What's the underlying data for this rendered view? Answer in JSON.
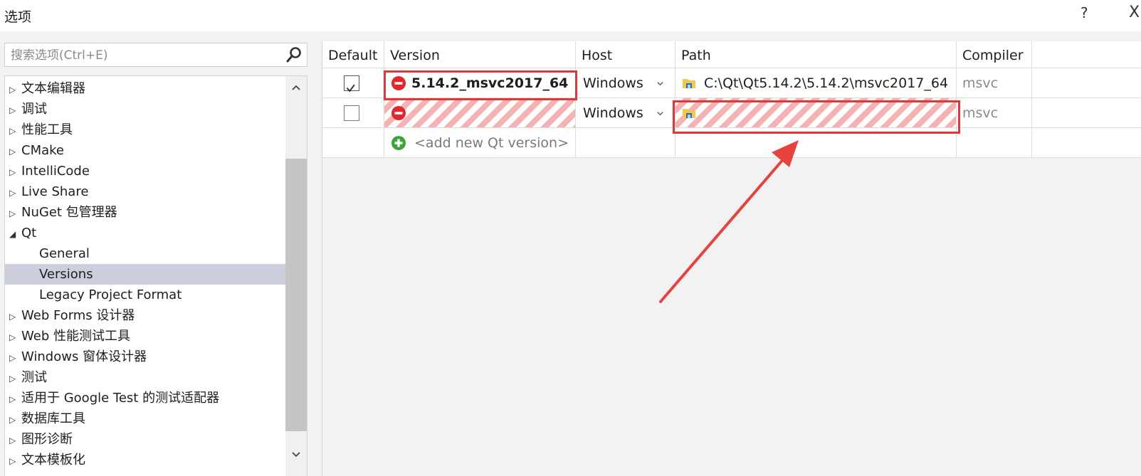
{
  "window": {
    "title": "选项",
    "help_label": "?",
    "close_label": "X"
  },
  "search": {
    "placeholder": "搜索选项(Ctrl+E)",
    "value": ""
  },
  "tree": {
    "items": [
      {
        "label": "文本编辑器",
        "expander": "▷"
      },
      {
        "label": "调试",
        "expander": "▷"
      },
      {
        "label": "性能工具",
        "expander": "▷"
      },
      {
        "label": "CMake",
        "expander": "▷"
      },
      {
        "label": "IntelliCode",
        "expander": "▷"
      },
      {
        "label": "Live Share",
        "expander": "▷"
      },
      {
        "label": "NuGet 包管理器",
        "expander": "▷"
      },
      {
        "label": "Qt",
        "expander": "◢"
      },
      {
        "label": "General",
        "expander": ""
      },
      {
        "label": "Versions",
        "expander": "",
        "selected": true
      },
      {
        "label": "Legacy Project Format",
        "expander": ""
      },
      {
        "label": "Web Forms 设计器",
        "expander": "▷"
      },
      {
        "label": "Web 性能测试工具",
        "expander": "▷"
      },
      {
        "label": "Windows 窗体设计器",
        "expander": "▷"
      },
      {
        "label": "测试",
        "expander": "▷"
      },
      {
        "label": "适用于 Google Test 的测试适配器",
        "expander": "▷"
      },
      {
        "label": "数据库工具",
        "expander": "▷"
      },
      {
        "label": "图形诊断",
        "expander": "▷"
      },
      {
        "label": "文本模板化",
        "expander": "▷"
      }
    ]
  },
  "grid": {
    "columns": [
      "Default",
      "Version",
      "Host",
      "Path",
      "Compiler"
    ],
    "rows": [
      {
        "default_checked": true,
        "version": "5.14.2_msvc2017_64",
        "host": "Windows",
        "path": "C:\\Qt\\Qt5.14.2\\5.14.2\\msvc2017_64",
        "compiler": "msvc"
      },
      {
        "default_checked": false,
        "version": "",
        "host": "Windows",
        "path": "",
        "compiler": "msvc"
      }
    ],
    "add_label": "<add new Qt version>"
  },
  "colors": {
    "annotation_red": "#e0383a",
    "error_red": "#e3262b",
    "add_green": "#3aa53a",
    "hatch_pink": "#f6b2b2",
    "selection": "#cccedb"
  },
  "icons": [
    "search-icon",
    "error-icon",
    "add-icon",
    "qt-folder-icon",
    "chevron-down-icon",
    "checkmark-icon"
  ]
}
